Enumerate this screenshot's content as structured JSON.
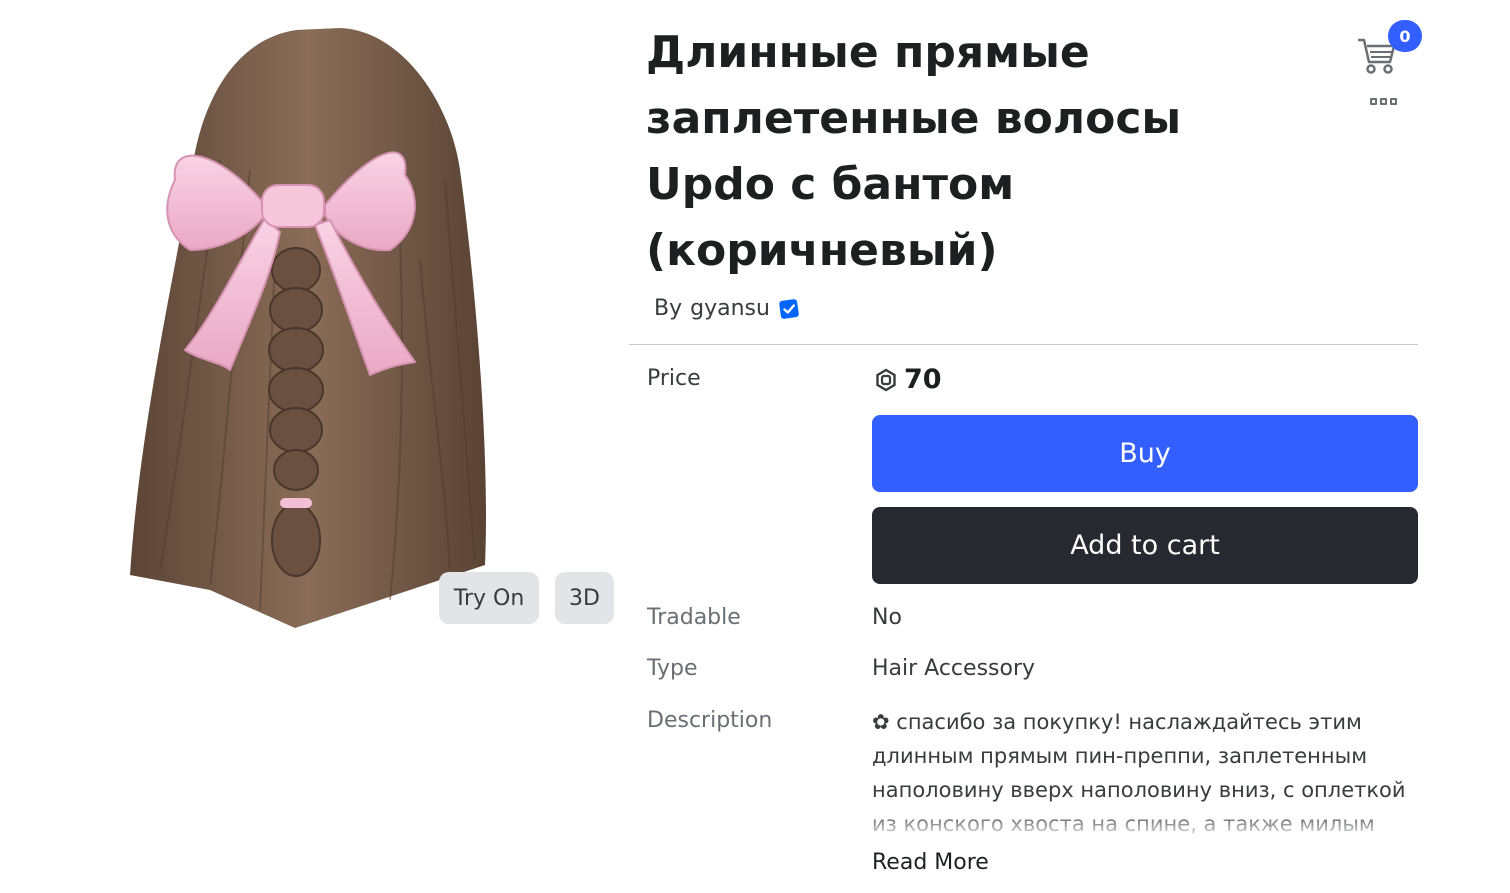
{
  "item": {
    "title": "Длинные прямые заплетенные волосы Updo с бантом (коричневый)",
    "creator_prefix": "By",
    "creator_name": "gyansu",
    "creator_verified": true
  },
  "media": {
    "try_on_label": "Try On",
    "view_3d_label": "3D"
  },
  "header": {
    "cart_count": "0"
  },
  "details": {
    "price_label": "Price",
    "price_value": "70",
    "buy_label": "Buy",
    "add_to_cart_label": "Add to cart",
    "tradable_label": "Tradable",
    "tradable_value": "No",
    "type_label": "Type",
    "type_value": "Hair Accessory",
    "description_label": "Description",
    "description_text": "✿ спасибо за покупку! наслаждайтесь этим длинным прямым пин-преппи, заплетенным наполовину вверх наполовину вниз, с оплеткой из конского хвоста на спине, а также милым",
    "read_more_label": "Read More"
  },
  "colors": {
    "buy_button": "#335fff",
    "cart_button": "#272930",
    "badge": "#335fff",
    "verified_badge": "#0066ff",
    "hair": "#7a5f4d",
    "bow": "#f4bfd6"
  },
  "icons": {
    "cart": "shopping-cart-icon",
    "more": "more-options-icon",
    "robux": "robux-icon",
    "verified": "verified-badge-icon"
  }
}
